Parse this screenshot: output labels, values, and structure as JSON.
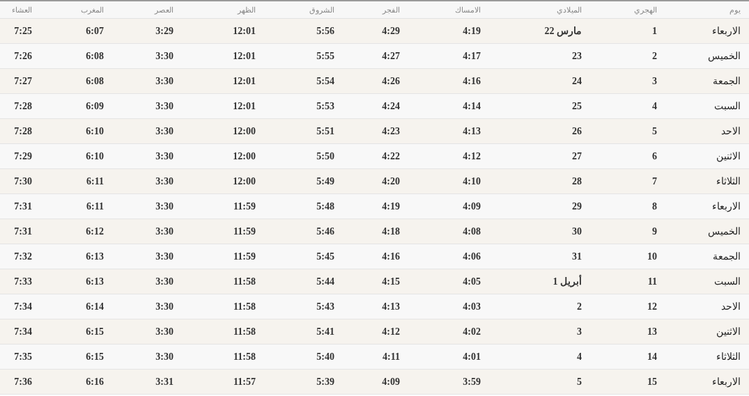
{
  "table": {
    "columns": [
      "العشاء",
      "المغرب",
      "العصر",
      "الظهر",
      "الشروق",
      "الفجر",
      "الامساك",
      "الميلادي",
      "الهجري",
      "يوم"
    ],
    "rows": [
      [
        "7:25",
        "6:07",
        "3:29",
        "12:01",
        "5:56",
        "4:29",
        "4:19",
        "22 مارس",
        "1",
        "الاربعاء"
      ],
      [
        "7:26",
        "6:08",
        "3:30",
        "12:01",
        "5:55",
        "4:27",
        "4:17",
        "23",
        "2",
        "الخميس"
      ],
      [
        "7:27",
        "6:08",
        "3:30",
        "12:01",
        "5:54",
        "4:26",
        "4:16",
        "24",
        "3",
        "الجمعة"
      ],
      [
        "7:28",
        "6:09",
        "3:30",
        "12:01",
        "5:53",
        "4:24",
        "4:14",
        "25",
        "4",
        "السبت"
      ],
      [
        "7:28",
        "6:10",
        "3:30",
        "12:00",
        "5:51",
        "4:23",
        "4:13",
        "26",
        "5",
        "الاحد"
      ],
      [
        "7:29",
        "6:10",
        "3:30",
        "12:00",
        "5:50",
        "4:22",
        "4:12",
        "27",
        "6",
        "الاثنين"
      ],
      [
        "7:30",
        "6:11",
        "3:30",
        "12:00",
        "5:49",
        "4:20",
        "4:10",
        "28",
        "7",
        "الثلاثاء"
      ],
      [
        "7:31",
        "6:11",
        "3:30",
        "11:59",
        "5:48",
        "4:19",
        "4:09",
        "29",
        "8",
        "الاربعاء"
      ],
      [
        "7:31",
        "6:12",
        "3:30",
        "11:59",
        "5:46",
        "4:18",
        "4:08",
        "30",
        "9",
        "الخميس"
      ],
      [
        "7:32",
        "6:13",
        "3:30",
        "11:59",
        "5:45",
        "4:16",
        "4:06",
        "31",
        "10",
        "الجمعة"
      ],
      [
        "7:33",
        "6:13",
        "3:30",
        "11:58",
        "5:44",
        "4:15",
        "4:05",
        "1 أبريل",
        "11",
        "السبت"
      ],
      [
        "7:34",
        "6:14",
        "3:30",
        "11:58",
        "5:43",
        "4:13",
        "4:03",
        "2",
        "12",
        "الاحد"
      ],
      [
        "7:34",
        "6:15",
        "3:30",
        "11:58",
        "5:41",
        "4:12",
        "4:02",
        "3",
        "13",
        "الاثنين"
      ],
      [
        "7:35",
        "6:15",
        "3:30",
        "11:58",
        "5:40",
        "4:11",
        "4:01",
        "4",
        "14",
        "الثلاثاء"
      ],
      [
        "7:36",
        "6:16",
        "3:31",
        "11:57",
        "5:39",
        "4:09",
        "3:59",
        "5",
        "15",
        "الاربعاء"
      ]
    ]
  }
}
